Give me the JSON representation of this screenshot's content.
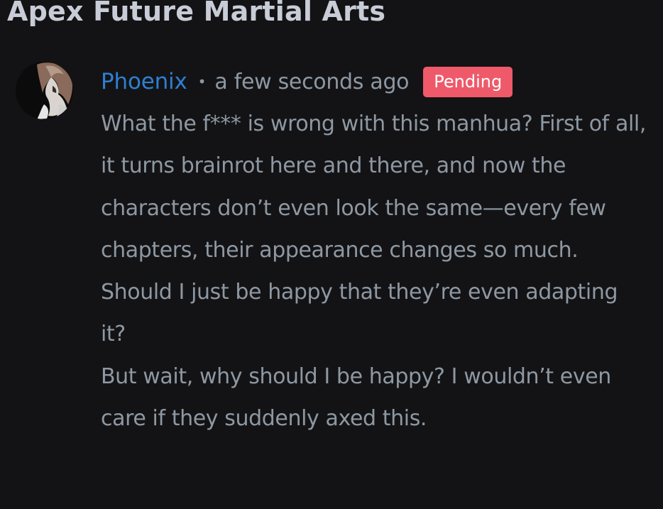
{
  "page": {
    "title": "Apex Future Martial Arts"
  },
  "comment": {
    "username": "Phoenix",
    "separator": "•",
    "timestamp": "a few seconds ago",
    "status_badge": "Pending",
    "paragraphs": [
      "What the f*** is wrong with this manhua? First of all, it turns brainrot here and there, and now the characters don’t even look the same—every few chapters, their appearance changes so much.",
      "Should I just be happy that they’re even adapting it?",
      "But wait, why should I be happy? I wouldn’t even care if they suddenly axed this."
    ]
  },
  "colors": {
    "background": "#131315",
    "title": "#c8ccd6",
    "username": "#2f7fd1",
    "text": "#8e98a3",
    "badge_bg": "#ee5a6a",
    "badge_text": "#ffffff"
  },
  "icons": {
    "avatar": "user-avatar-image"
  }
}
